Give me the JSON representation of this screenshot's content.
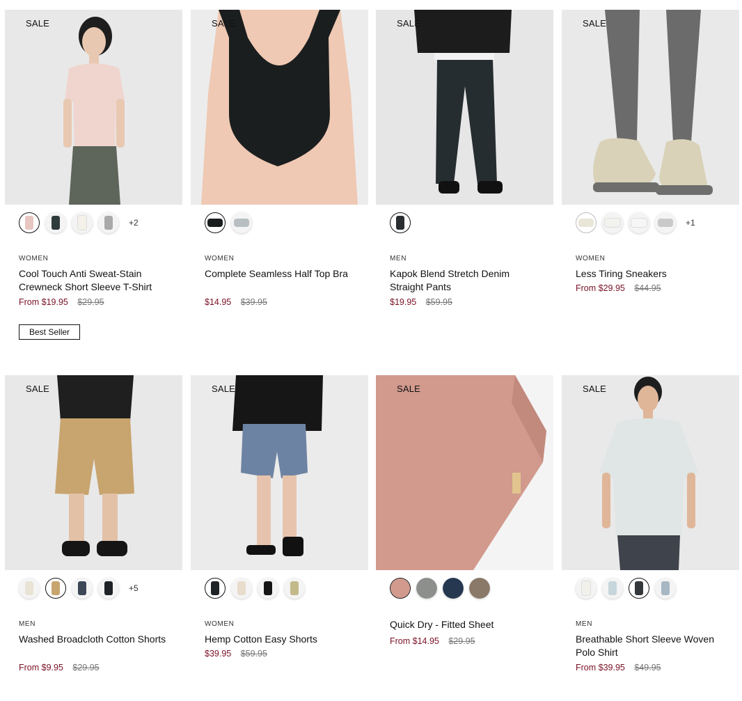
{
  "products": [
    {
      "sale_label": "SALE",
      "category": "WOMEN",
      "name": "Cool Touch Anti Sweat-Stain Crewneck Short Sleeve T-Shirt",
      "price_now": "From $19.95",
      "price_was": "$29.95",
      "badge": "Best Seller",
      "more_colors": "+2",
      "swatch_colors": [
        "#e8c6c1",
        "#2f3a3a",
        "#f4f1ea",
        "#a9a9a9"
      ]
    },
    {
      "sale_label": "SALE",
      "category": "WOMEN",
      "name": "Complete Seamless Half Top Bra",
      "price_now": "$14.95",
      "price_was": "$39.95",
      "swatch_colors": [
        "#1b1e1e",
        "#b8bfc2"
      ]
    },
    {
      "sale_label": "SALE",
      "category": "MEN",
      "name": "Kapok Blend Stretch Denim Straight Pants",
      "price_now": "$19.95",
      "price_was": "$59.95",
      "swatch_colors": [
        "#2a2e30"
      ]
    },
    {
      "sale_label": "SALE",
      "category": "WOMEN",
      "name": "Less Tiring Sneakers",
      "price_now": "From $29.95",
      "price_was": "$44.95",
      "more_colors": "+1",
      "swatch_colors": [
        "#e9e5d8",
        "#f2f2ef",
        "#f6f6f6",
        "#c9c9c9"
      ]
    },
    {
      "sale_label": "SALE",
      "category": "MEN",
      "name": "Washed Broadcloth Cotton Shorts",
      "price_now": "From $9.95",
      "price_was": "$29.95",
      "more_colors": "+5",
      "swatch_colors": [
        "#e9e3d6",
        "#c8a46e",
        "#3d4655",
        "#1f2226"
      ]
    },
    {
      "sale_label": "SALE",
      "category": "WOMEN",
      "name": "Hemp Cotton Easy Shorts",
      "price_now": "$39.95",
      "price_was": "$59.95",
      "swatch_colors": [
        "#1f2226",
        "#e8dccd",
        "#151515",
        "#c4b98a"
      ]
    },
    {
      "sale_label": "SALE",
      "category": "",
      "name": "Quick Dry - Fitted Sheet",
      "price_now": "From $14.95",
      "price_was": "$29.95",
      "swatch_colors": [
        "#d19a8d",
        "#8c8f8c",
        "#263850",
        "#8a7868"
      ]
    },
    {
      "sale_label": "SALE",
      "category": "MEN",
      "name": "Breathable Short Sleeve Woven Polo Shirt",
      "price_now": "From $39.95",
      "price_was": "$49.95",
      "swatch_colors": [
        "#f1f0ea",
        "#c7d6dc",
        "#34383c",
        "#a7b8c4"
      ]
    }
  ]
}
